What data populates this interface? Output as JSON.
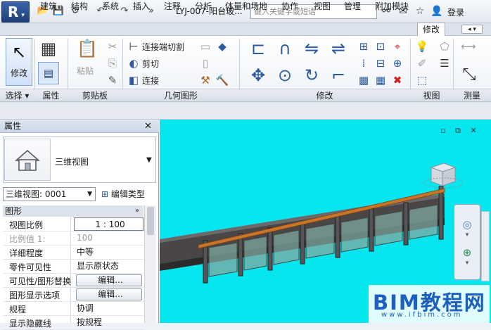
{
  "app": {
    "logo_letter": "R"
  },
  "quick_access": {
    "icons": [
      "open-folder-icon",
      "save-icon",
      "sync-icon",
      "undo-icon",
      "redo-icon",
      "more-icon"
    ]
  },
  "title": {
    "document": "LYJ-007-阳台玻..."
  },
  "search": {
    "placeholder": "键入关键字或短语"
  },
  "right_controls": {
    "icons": [
      "binoculars-icon",
      "infocenter-icon",
      "star-icon",
      "user-icon"
    ],
    "login": "登录"
  },
  "tabs": [
    "建筑",
    "结构",
    "系统",
    "插入",
    "注释",
    "分析",
    "体量和场地",
    "协作",
    "视图",
    "管理",
    "附加模块"
  ],
  "active_tab": "修改",
  "ribbon": {
    "modify_label": "修改",
    "paste_label": "粘贴",
    "cut_join": "连接端切割",
    "cut": "剪切",
    "join": "连接",
    "panels": {
      "select": "选择",
      "properties": "属性",
      "clipboard": "剪贴板",
      "geometry": "几何图形",
      "modify": "修改",
      "view": "视图",
      "measure": "测量"
    }
  },
  "properties": {
    "title": "属性",
    "type_name": "三维视图",
    "view_selector": "三维视图: 0001",
    "edit_type": "编辑类型",
    "group": "图形",
    "rows": [
      {
        "key": "视图比例",
        "value": "1 : 100"
      },
      {
        "key": "比例值 1:",
        "value": "100"
      },
      {
        "key": "详细程度",
        "value": "中等"
      },
      {
        "key": "零件可见性",
        "value": "显示原状态"
      },
      {
        "key": "可见性/图形替换",
        "value": "编辑..."
      },
      {
        "key": "图形显示选项",
        "value": "编辑..."
      },
      {
        "key": "规程",
        "value": "协调"
      },
      {
        "key": "显示隐藏线",
        "value": "按规程"
      }
    ]
  },
  "viewport": {
    "background": "#06e6ee"
  },
  "watermark": {
    "main": "BIM教程网",
    "url": "www.ifbim.com"
  }
}
